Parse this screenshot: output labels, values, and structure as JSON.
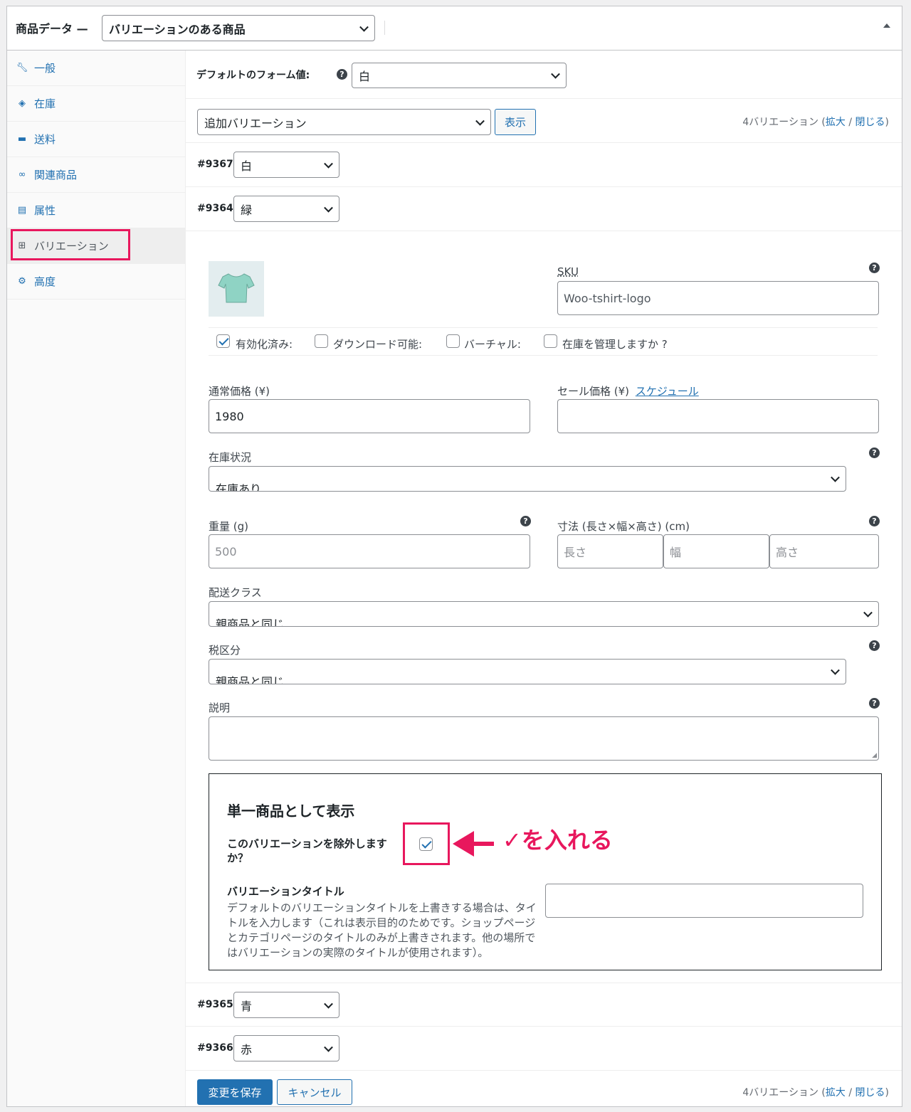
{
  "header": {
    "title": "商品データ —",
    "product_type": "バリエーションのある商品"
  },
  "sidebar": {
    "items": [
      {
        "label": "一般",
        "icon": "wrench-icon"
      },
      {
        "label": "在庫",
        "icon": "tag-icon"
      },
      {
        "label": "送料",
        "icon": "truck-icon"
      },
      {
        "label": "関連商品",
        "icon": "link-icon"
      },
      {
        "label": "属性",
        "icon": "list-icon"
      },
      {
        "label": "バリエーション",
        "icon": "grid-icon"
      },
      {
        "label": "高度",
        "icon": "gear-icon"
      }
    ]
  },
  "defaults": {
    "label": "デフォルトのフォーム値:",
    "value": "白"
  },
  "toolbar": {
    "bulk_action": "追加バリエーション",
    "show_button": "表示",
    "count": "4バリエーション (",
    "expand": "拡大",
    "slash": " / ",
    "close": "閉じる",
    "paren": ")"
  },
  "variations": [
    {
      "id": "#9367",
      "value": "白"
    },
    {
      "id": "#9364",
      "value": "緑"
    },
    {
      "id": "#9365",
      "value": "青"
    },
    {
      "id": "#9366",
      "value": "赤"
    }
  ],
  "detail": {
    "sku_label": "SKU",
    "sku_value": "Woo-tshirt-logo",
    "enabled_label": "有効化済み:",
    "downloadable_label": "ダウンロード可能:",
    "virtual_label": "バーチャル:",
    "manage_stock_label": "在庫を管理しますか ?",
    "regular_price_label": "通常価格 (¥)",
    "regular_price_value": "1980",
    "sale_price_label": "セール価格 (¥)",
    "schedule_link": "スケジュール",
    "stock_status_label": "在庫状況",
    "stock_status_value": "在庫あり",
    "weight_label": "重量 (g)",
    "weight_placeholder": "500",
    "dimensions_label": "寸法 (長さ×幅×高さ) (cm)",
    "length_placeholder": "長さ",
    "width_placeholder": "幅",
    "height_placeholder": "高さ",
    "shipping_class_label": "配送クラス",
    "shipping_class_value": "親商品と同じ",
    "tax_class_label": "税区分",
    "tax_class_value": "親商品と同じ",
    "description_label": "説明"
  },
  "single_product": {
    "title": "単一商品として表示",
    "exclude_label_1": "このバリエーションを除外します",
    "exclude_label_2": "か？",
    "variation_title_label": "バリエーションタイトル",
    "variation_title_desc": "デフォルトのバリエーションタイトルを上書きする場合は、タイトルを入力します（これは表示目的のためです。ショップページとカテゴリページのタイトルのみが上書きされます。他の場所ではバリエーションの実際のタイトルが使用されます）。"
  },
  "annotation": {
    "text": "✓を入れる"
  },
  "footer": {
    "save_button": "変更を保存",
    "cancel_button": "キャンセル"
  },
  "colors": {
    "accent": "#2271b1",
    "highlight": "#e8175d"
  }
}
